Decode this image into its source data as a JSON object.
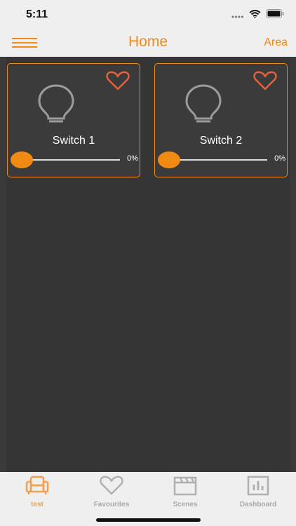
{
  "status": {
    "time": "5:11"
  },
  "nav": {
    "title": "Home",
    "area_label": "Area"
  },
  "devices": [
    {
      "name": "Switch 1",
      "value_text": "0%",
      "level": 0,
      "favourite": true
    },
    {
      "name": "Switch 2",
      "value_text": "0%",
      "level": 0,
      "favourite": true
    }
  ],
  "tabs": [
    {
      "label": "test",
      "icon": "sofa-icon",
      "active": true
    },
    {
      "label": "Favourites",
      "icon": "heart-icon",
      "active": false
    },
    {
      "label": "Scenes",
      "icon": "clapperboard-icon",
      "active": false
    },
    {
      "label": "Dashboard",
      "icon": "bar-chart-icon",
      "active": false
    }
  ],
  "colors": {
    "accent": "#f08a12",
    "heart": "#e8613a",
    "background": "#3a3a3a",
    "bar": "#efefef"
  }
}
